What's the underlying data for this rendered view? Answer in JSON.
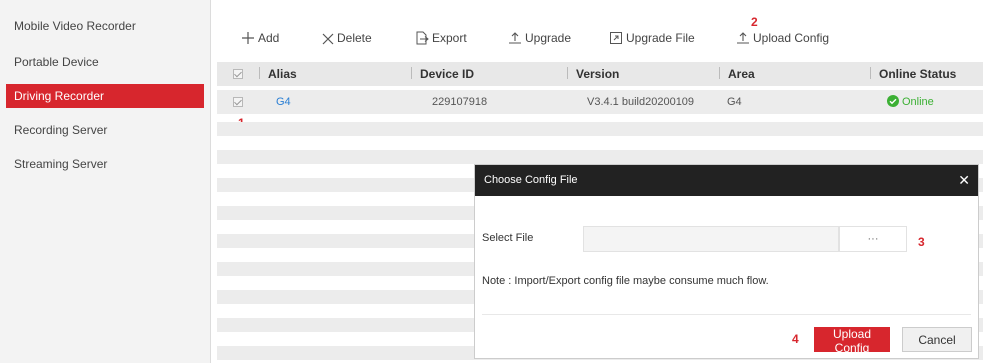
{
  "sidebar": {
    "items": [
      {
        "label": "Mobile Video Recorder"
      },
      {
        "label": "Portable Device"
      },
      {
        "label": "Driving Recorder"
      },
      {
        "label": "Recording Server"
      },
      {
        "label": "Streaming Server"
      }
    ],
    "active_index": 2
  },
  "toolbar": {
    "add": "Add",
    "delete": "Delete",
    "export": "Export",
    "upgrade": "Upgrade",
    "upgrade_file": "Upgrade File",
    "upload_config": "Upload Config"
  },
  "table": {
    "headers": [
      "Alias",
      "Device ID",
      "Version",
      "Area",
      "Online Status"
    ],
    "rows": [
      {
        "alias": "G4",
        "device_id": "229107918",
        "version": "V3.4.1 build20200109",
        "area": "G4",
        "status": "Online"
      }
    ]
  },
  "modal": {
    "title": "Choose Config File",
    "select_file_label": "Select File",
    "file_value": "",
    "browse_label": "···",
    "note": "Note : Import/Export config file maybe consume much flow.",
    "upload_button": "Upload Config",
    "cancel_button": "Cancel"
  },
  "callouts": {
    "c1": "1",
    "c2": "2",
    "c3": "3",
    "c4": "4"
  },
  "colors": {
    "accent": "#d7262d",
    "link": "#2a7fd4",
    "online": "#3cb034",
    "modal_header": "#222222"
  }
}
